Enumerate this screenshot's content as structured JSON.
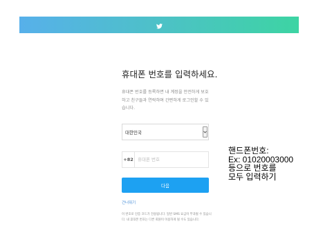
{
  "header": {
    "icon": "twitter-bird-icon",
    "bar_color_start": "#57b0ea",
    "bar_color_end": "#3dd4a3"
  },
  "form": {
    "title": "휴대폰 번호를 입력하세요.",
    "description": "휴대폰 번호를 등록하면 내 계정을 안전하게 보호하고 친구들과 연락하며 간편하게 로그인할 수 있습니다.",
    "country_select": {
      "value": "대한민국",
      "icon": "chevron-down-icon"
    },
    "phone": {
      "country_code": "+82",
      "placeholder": "휴대폰 번호",
      "value": ""
    },
    "next_button": "다음",
    "skip_link": "건너뛰기",
    "notice": "이 번호로 인증 코드가 전송됩니다. 일반 SMS 요금이 부과될 수 있습니다. 내 휴대폰 번호는 다른 회원이 이용하게 될 수도 있습니다.",
    "accent_color": "#1da1f2"
  },
  "annotation": {
    "lines": [
      "핸드폰번호:",
      "Ex: 01020003000",
      "등으로 번호를",
      "모두 입력하기"
    ]
  }
}
